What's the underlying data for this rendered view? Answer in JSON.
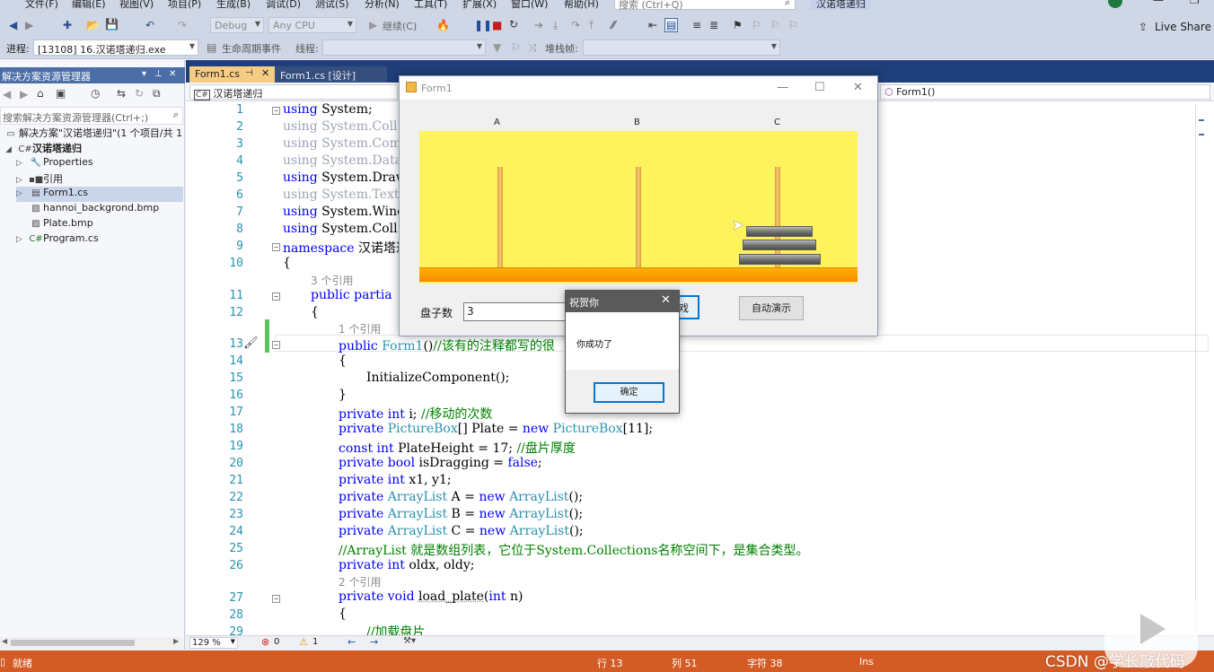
{
  "menu": [
    "文件(F)",
    "编辑(E)",
    "视图(V)",
    "项目(P)",
    "生成(B)",
    "调试(D)",
    "测试(S)",
    "分析(N)",
    "工具(T)",
    "扩展(X)",
    "窗口(W)",
    "帮助(H)"
  ],
  "search_placeholder": "搜索 (Ctrl+Q)",
  "solution_name": "汉诺塔递归",
  "toolbar": {
    "config": "Debug",
    "platform": "Any CPU",
    "continue": "继续(C)",
    "live_share": "Live Share",
    "process_label": "进程:",
    "process_value": "[13108] 16.汉诺塔递归.exe",
    "lifecycle": "生命周期事件",
    "thread": "线程:",
    "stack_frame": "堆栈帧:"
  },
  "solution_explorer": {
    "title": "解决方案资源管理器",
    "search": "搜索解决方案资源管理器(Ctrl+;)",
    "items": [
      {
        "label": "解决方案\"汉诺塔递归\"(1 个项目/共 1",
        "icon": "solution-icon"
      },
      {
        "label": "汉诺塔递归",
        "icon": "csharp-project-icon"
      },
      {
        "label": "Properties",
        "icon": "wrench-icon"
      },
      {
        "label": "引用",
        "icon": "references-icon"
      },
      {
        "label": "Form1.cs",
        "icon": "form-icon"
      },
      {
        "label": "hannoi_backgrond.bmp",
        "icon": "image-icon"
      },
      {
        "label": "Plate.bmp",
        "icon": "image-icon"
      },
      {
        "label": "Program.cs",
        "icon": "csharp-file-icon"
      }
    ]
  },
  "tabs": {
    "active": "Form1.cs",
    "design": "Form1.cs [设计]"
  },
  "nav": {
    "project": "汉诺塔递归",
    "member": "Form1()"
  },
  "code": {
    "line_numbers": [
      "1",
      "2",
      "3",
      "4",
      "5",
      "6",
      "7",
      "8",
      "9",
      "10",
      "11",
      "12",
      "13",
      "14",
      "15",
      "16",
      "17",
      "18",
      "19",
      "20",
      "21",
      "22",
      "23",
      "24",
      "25",
      "26",
      "27",
      "28",
      "29"
    ],
    "ref_count_3": "3 个引用",
    "ref_count_1": "1 个引用",
    "ref_count_2": "2 个引用",
    "l1": "System;",
    "l2": "System.Coll",
    "l3": "System.Comp",
    "l4": "System.Data",
    "l5": "System.Draw",
    "l6": "System.Text",
    "l7": "System.Winc",
    "l8": "System.Coll",
    "l9": " 汉诺塔递",
    "l11": "public partia",
    "l13_comment": "//该有的注释都写的很",
    "l15": "InitializeComponent();",
    "l17": "private int i; //移动的次数",
    "l18a": "private ",
    "l18b": "PictureBox",
    "l18c": "[] Plate = ",
    "l18d": "new ",
    "l18e": "PictureBox",
    "l18f": "[11];",
    "l19": "const int PlateHeight = 17; //盘片厚度",
    "l20": "private bool isDragging = false;",
    "l21": "private int x1, y1;",
    "l22": "private ArrayList A = new ArrayList();",
    "l23": "private ArrayList B = new ArrayList();",
    "l24": "private ArrayList C = new ArrayList();",
    "l25": "//ArrayList 就是数组列表，它位于System.Collections名称空间下，是集合类型。",
    "l26": "private int oldx, oldy;",
    "l27": "private void load_plate(int n)",
    "l29": "//加载盘片"
  },
  "editor_footer": {
    "zoom": "129 %",
    "errors": "0",
    "warnings": "1"
  },
  "status": {
    "state": "就绪",
    "line": "行 13",
    "col": "列 51",
    "char": "字符 38",
    "mode": "Ins"
  },
  "form1": {
    "title": "Form1",
    "peg_a": "A",
    "peg_b": "B",
    "peg_c": "C",
    "plates_label": "盘子数",
    "plates_value": "3",
    "start_button": "戏",
    "auto_button": "自动演示",
    "plates_on_c": 3
  },
  "msgbox": {
    "title": "祝贺你",
    "text": "你成功了",
    "ok": "确定"
  },
  "watermark": "CSDN @学长敲代码"
}
